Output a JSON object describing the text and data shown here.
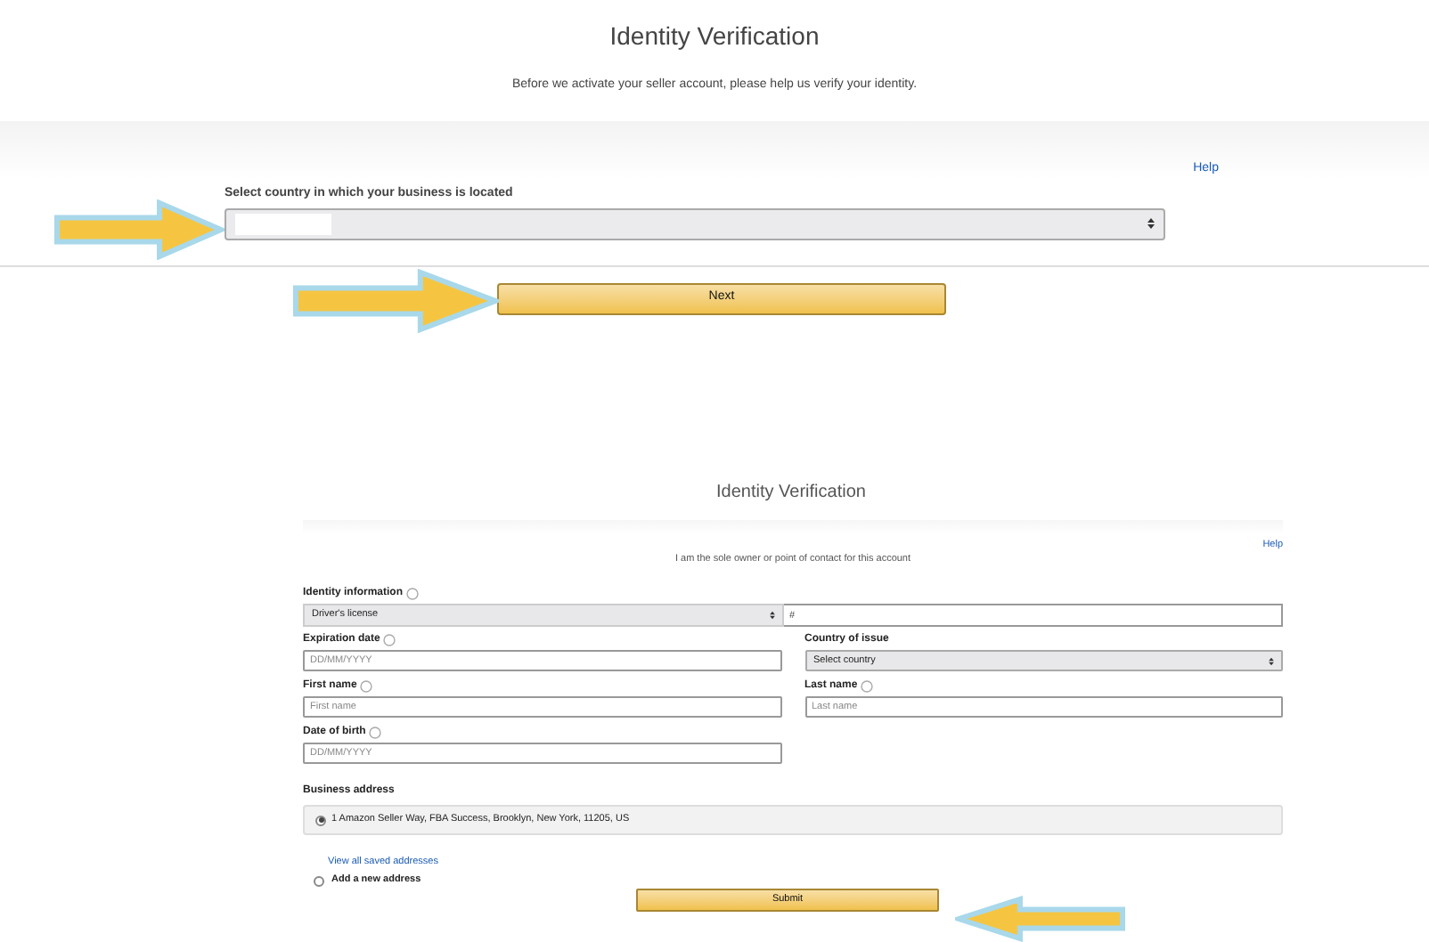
{
  "step1": {
    "title": "Identity Verification",
    "subtitle": "Before we activate your seller account, please help us verify your identity.",
    "help": "Help",
    "country_label": "Select country in which your business is located",
    "next_button": "Next"
  },
  "step2": {
    "title": "Identity Verification",
    "help": "Help",
    "subtitle": "I am the sole owner or point of contact for this account",
    "identity_label": "Identity information",
    "id_type": "Driver's license",
    "id_number_placeholder": "#",
    "expiration_label": "Expiration date",
    "expiration_placeholder": "DD/MM/YYYY",
    "country_issue_label": "Country of issue",
    "country_issue_value": "Select country",
    "first_name_label": "First name",
    "first_name_placeholder": "First name",
    "last_name_label": "Last name",
    "last_name_placeholder": "Last name",
    "dob_label": "Date of birth",
    "dob_placeholder": "DD/MM/YYYY",
    "address_label": "Business address",
    "addresses": [
      {
        "text": "1 Amazon Seller Way, FBA Success, Brooklyn, New York, 11205, US",
        "selected": true
      },
      {
        "text": "Add a new address",
        "selected": false
      }
    ],
    "view_all_link": "View all saved addresses",
    "submit_button": "Submit"
  }
}
